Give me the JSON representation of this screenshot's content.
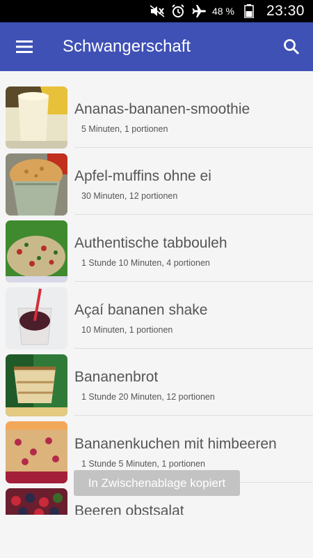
{
  "status_bar": {
    "battery_percent": "48 %",
    "time": "23:30",
    "icons": [
      "mute-icon",
      "alarm-icon",
      "airplane-mode-icon",
      "battery-icon"
    ]
  },
  "app_bar": {
    "title": "Schwangerschaft",
    "menu_icon": "hamburger-menu-icon",
    "search_icon": "search-icon",
    "color": "#3f51b5"
  },
  "recipes": [
    {
      "name": "Ananas-bananen-smoothie",
      "meta": "5 Minuten, 1 portionen",
      "image": "pineapple-banana-smoothie-photo"
    },
    {
      "name": "Apfel-muffins ohne ei",
      "meta": "30 Minuten, 12 portionen",
      "image": "apple-muffin-photo"
    },
    {
      "name": "Authentische tabbouleh",
      "meta": "1 Stunde 10 Minuten, 4 portionen",
      "image": "tabbouleh-photo"
    },
    {
      "name": "Açaí bananen shake",
      "meta": "10 Minuten, 1 portionen",
      "image": "acai-shake-photo"
    },
    {
      "name": "Bananenbrot",
      "meta": "1 Stunde 20 Minuten, 12 portionen",
      "image": "banana-bread-photo"
    },
    {
      "name": "Bananenkuchen mit himbeeren",
      "meta": "1 Stunde 5 Minuten, 1 portionen",
      "image": "banana-raspberry-cake-photo"
    },
    {
      "name": "Beeren obstsalat",
      "meta": "",
      "image": "berry-fruit-salad-photo"
    }
  ],
  "toast": {
    "text": "In Zwischenablage kopiert"
  }
}
